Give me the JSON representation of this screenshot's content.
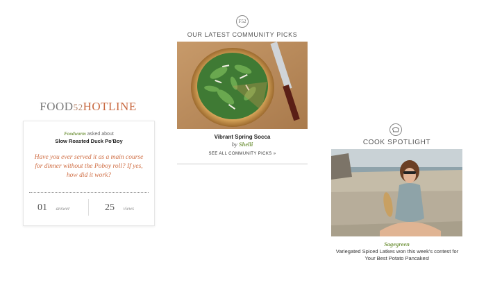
{
  "hotline": {
    "title_food": "FOOD",
    "title_num": "52",
    "title_hotline": "HOTLINE",
    "asker_user": "Foodworm",
    "asker_text": " asked about",
    "question_title": "Slow Roasted Duck Po'Boy",
    "question": "Have you ever served it as a main course for dinner without the Poboy roll? If yes, how did it work?",
    "answers_count": "01",
    "answers_label": "answer",
    "views_count": "25",
    "views_label": "views"
  },
  "community": {
    "badge": "F52",
    "heading": "OUR LATEST COMMUNITY PICKS",
    "pick_title": "Vibrant Spring Socca",
    "by_label": "by",
    "author": "Shelli",
    "see_all": "SEE ALL COMMUNITY PICKS »"
  },
  "spotlight": {
    "heading": "COOK SPOTLIGHT",
    "username": "Sagegreen",
    "description": "Variegated Spiced Latkes won this week's contest for Your Best Potato Pancakes!"
  }
}
